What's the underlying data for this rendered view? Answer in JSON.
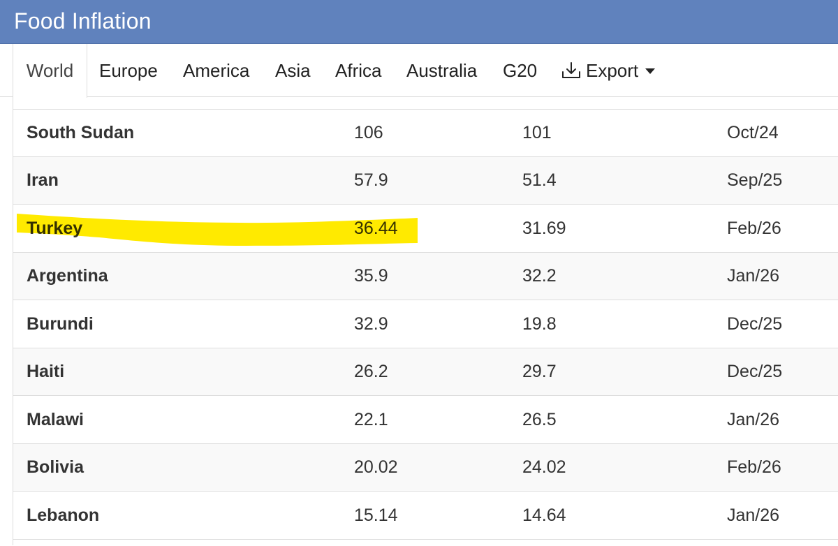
{
  "header": {
    "title": "Food Inflation"
  },
  "tabs": [
    {
      "label": "World",
      "active": true
    },
    {
      "label": "Europe",
      "active": false
    },
    {
      "label": "America",
      "active": false
    },
    {
      "label": "Asia",
      "active": false
    },
    {
      "label": "Africa",
      "active": false
    },
    {
      "label": "Australia",
      "active": false
    },
    {
      "label": "G20",
      "active": false
    }
  ],
  "export": {
    "label": "Export",
    "icon": "download-icon"
  },
  "colors": {
    "header_bg": "#6082bd",
    "highlight": "#ffea00",
    "border": "#dddddd"
  },
  "table": {
    "rows": [
      {
        "country": "South Sudan",
        "last": "106",
        "previous": "101",
        "reference": "Oct/24"
      },
      {
        "country": "Iran",
        "last": "57.9",
        "previous": "51.4",
        "reference": "Sep/25"
      },
      {
        "country": "Turkey",
        "last": "36.44",
        "previous": "31.69",
        "reference": "Feb/26",
        "highlighted": true
      },
      {
        "country": "Argentina",
        "last": "35.9",
        "previous": "32.2",
        "reference": "Jan/26"
      },
      {
        "country": "Burundi",
        "last": "32.9",
        "previous": "19.8",
        "reference": "Dec/25"
      },
      {
        "country": "Haiti",
        "last": "26.2",
        "previous": "29.7",
        "reference": "Dec/25"
      },
      {
        "country": "Malawi",
        "last": "22.1",
        "previous": "26.5",
        "reference": "Jan/26"
      },
      {
        "country": "Bolivia",
        "last": "20.02",
        "previous": "24.02",
        "reference": "Feb/26"
      },
      {
        "country": "Lebanon",
        "last": "15.14",
        "previous": "14.64",
        "reference": "Jan/26"
      }
    ]
  }
}
